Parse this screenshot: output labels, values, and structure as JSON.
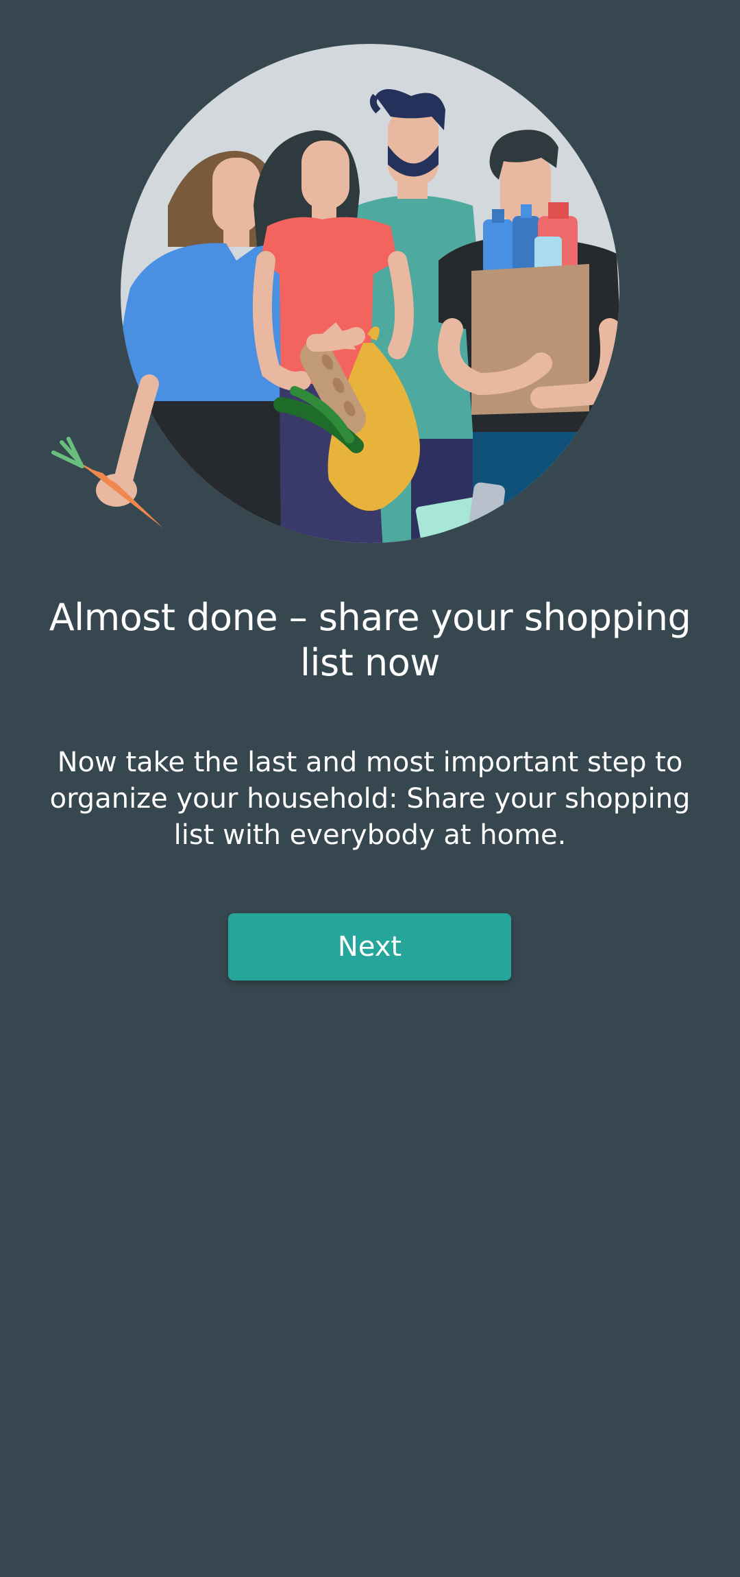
{
  "onboarding": {
    "title": "Almost done – share your shopping list now",
    "body": "Now take the last and most important step to organize your household: Share your shopping list with everybody at home.",
    "next_label": "Next"
  },
  "colors": {
    "background": "#37474f",
    "accent": "#26a69a",
    "text": "#ffffff"
  }
}
